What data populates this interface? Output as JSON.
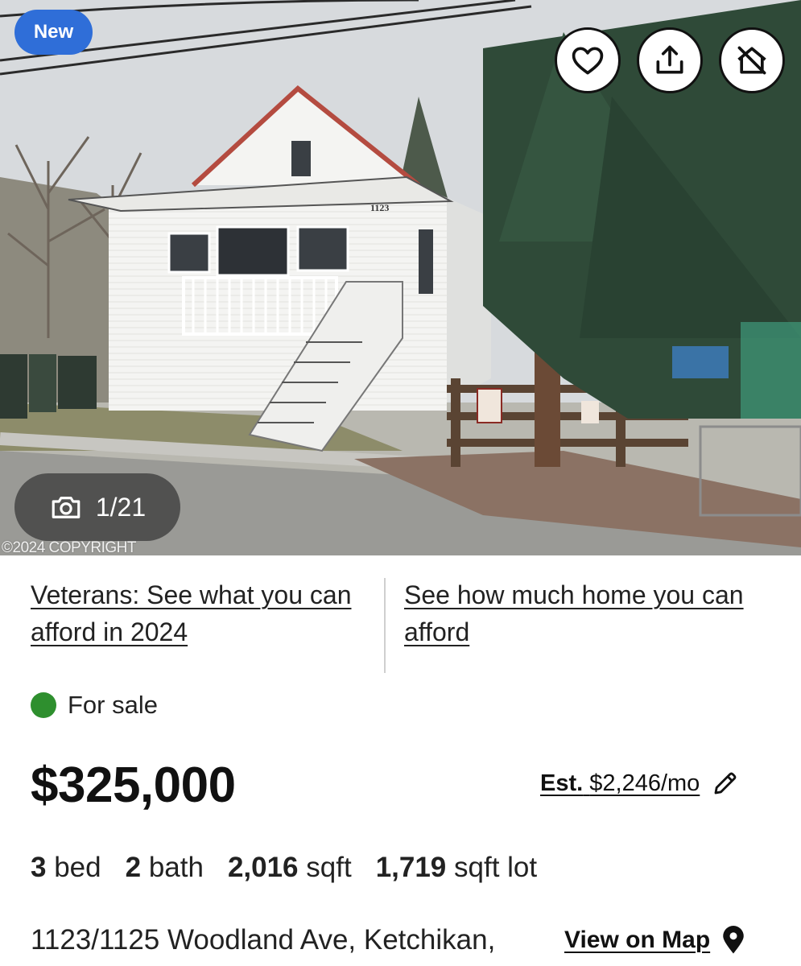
{
  "hero": {
    "badge": "New",
    "photo_counter": "1/21",
    "copyright": "©2024 COPYRIGHT",
    "house_number_sign": "1123",
    "actions": {
      "favorite_icon": "heart-icon",
      "share_icon": "share-icon",
      "hide_icon": "hide-home-icon"
    }
  },
  "promos": {
    "veterans_link": "Veterans: See what you can afford in 2024",
    "afford_link": "See how much home you can afford"
  },
  "listing": {
    "status": "For sale",
    "status_color": "#2e8f2e",
    "price": "$325,000",
    "est_label": "Est.",
    "est_value": "$2,246/mo",
    "facts": {
      "beds_value": "3",
      "beds_label": "bed",
      "baths_value": "2",
      "baths_label": "bath",
      "sqft_value": "2,016",
      "sqft_label": "sqft",
      "lot_value": "1,719",
      "lot_label": "sqft lot"
    },
    "address": "1123/1125 Woodland Ave, Ketchikan,",
    "view_on_map": "View on Map"
  },
  "colors": {
    "badge_blue": "#2f6ed8",
    "text_primary": "#111111"
  }
}
